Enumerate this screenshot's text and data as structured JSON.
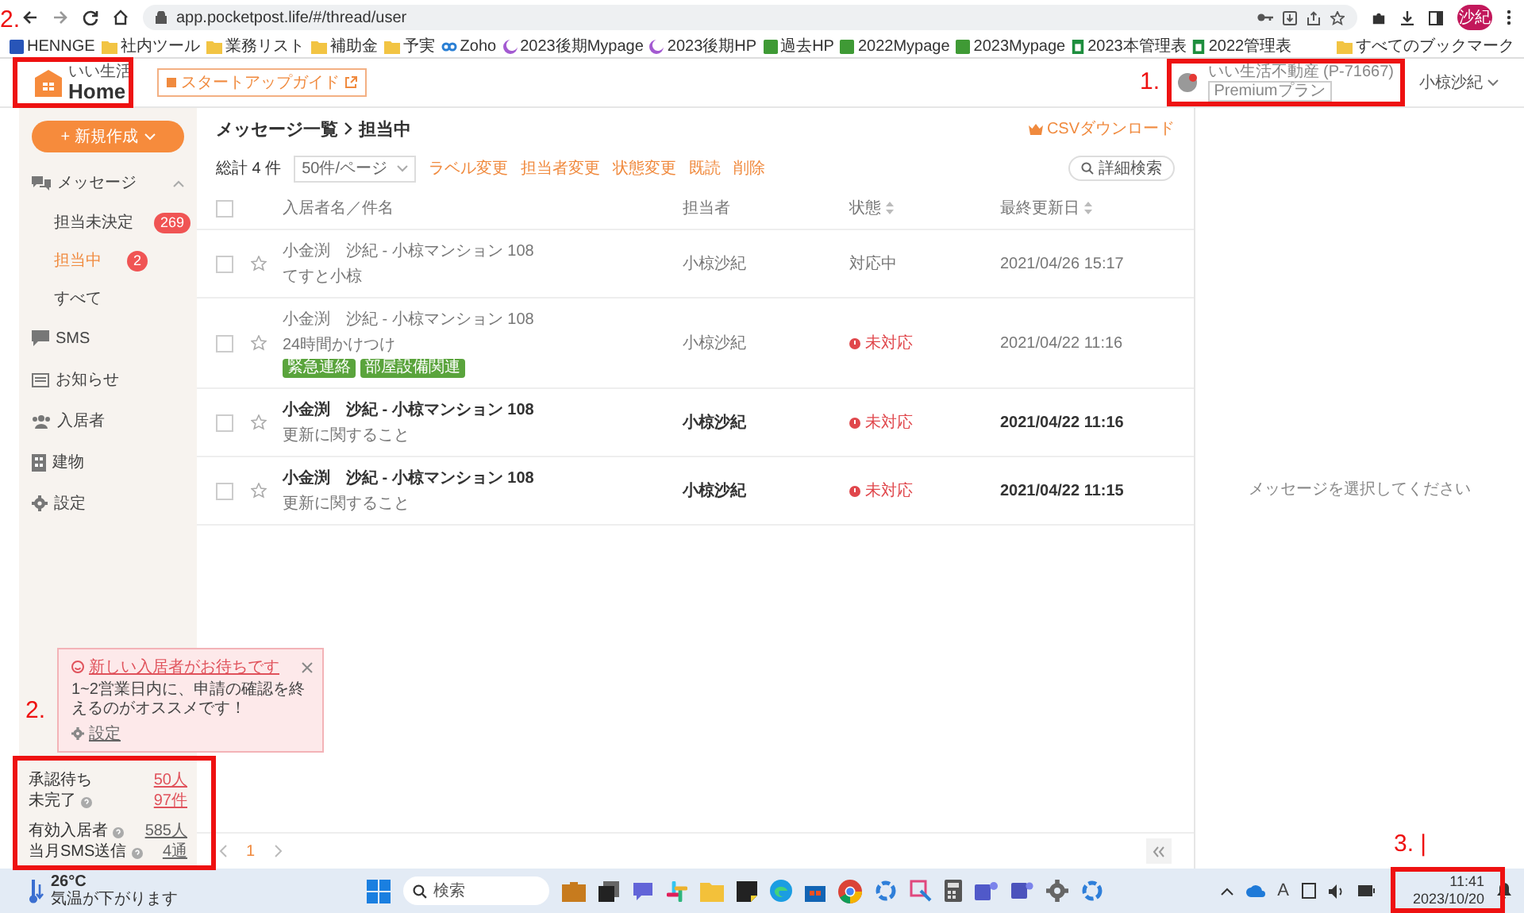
{
  "browser": {
    "url": "app.pocketpost.life/#/thread/user",
    "avatar": "沙紀",
    "all_bookmarks": "すべてのブックマーク",
    "bookmarks": [
      {
        "label": "HENNGE",
        "kind": "app"
      },
      {
        "label": "社内ツール",
        "kind": "folder"
      },
      {
        "label": "業務リスト",
        "kind": "folder"
      },
      {
        "label": "補助金",
        "kind": "folder"
      },
      {
        "label": "予実",
        "kind": "folder"
      },
      {
        "label": "Zoho",
        "kind": "zoho"
      },
      {
        "label": "2023後期Mypage",
        "kind": "mypage"
      },
      {
        "label": "2023後期HP",
        "kind": "mypage"
      },
      {
        "label": "過去HP",
        "kind": "site"
      },
      {
        "label": "2022Mypage",
        "kind": "site"
      },
      {
        "label": "2023Mypage",
        "kind": "site"
      },
      {
        "label": "2023本管理表",
        "kind": "sheet"
      },
      {
        "label": "2022管理表",
        "kind": "sheet"
      }
    ]
  },
  "header": {
    "logo_small": "いい生活",
    "logo": "Home",
    "guide": "スタートアップガイド",
    "company": "いい生活不動産 (P-71667)",
    "plan": "Premiumプラン",
    "user": "小椋沙紀"
  },
  "sidebar": {
    "new_button": "+ 新規作成",
    "items": [
      {
        "label": "メッセージ",
        "kind": "chat",
        "expanded": true,
        "children": [
          {
            "label": "担当未決定",
            "badge": "269",
            "selected": false
          },
          {
            "label": "担当中",
            "badge": "2",
            "selected": true
          },
          {
            "label": "すべて",
            "selected": false
          }
        ]
      },
      {
        "label": "SMS",
        "kind": "sms"
      },
      {
        "label": "お知らせ",
        "kind": "notice"
      },
      {
        "label": "入居者",
        "kind": "residents"
      },
      {
        "label": "建物",
        "kind": "building"
      },
      {
        "label": "設定",
        "kind": "settings"
      }
    ],
    "stats": [
      {
        "label": "承認待ち",
        "value": "50人",
        "help": false,
        "alert": true
      },
      {
        "label": "未完了",
        "value": "97件",
        "help": true,
        "alert": true
      },
      {
        "label": "有効入居者",
        "value": "585人",
        "help": true,
        "alert": false
      },
      {
        "label": "当月SMS送信",
        "value": "4通",
        "help": true,
        "alert": false
      }
    ]
  },
  "popup": {
    "title": "新しい入居者がお待ちです",
    "text": "1~2営業日内に、申請の確認を終えるのがオススメです！",
    "settings": "設定"
  },
  "list": {
    "breadcrumb": [
      "メッセージ一覧",
      "担当中"
    ],
    "csv": "CSVダウンロード",
    "total": "総計 4 件",
    "page_size": "50件/ページ",
    "actions": [
      "ラベル変更",
      "担当者変更",
      "状態変更",
      "既読",
      "削除"
    ],
    "search_button": "詳細検索",
    "columns": [
      {
        "label": "入居者名／件名",
        "sortable": false
      },
      {
        "label": "担当者",
        "sortable": false
      },
      {
        "label": "状態",
        "sortable": true
      },
      {
        "label": "最終更新日",
        "sortable": true
      }
    ],
    "all_checked": false,
    "rows": [
      {
        "checked": false,
        "name": "小金渕　沙紀 - 小椋マンション 108",
        "subject": "てすと小椋",
        "labels": [],
        "assignee": "小椋沙紀",
        "status": "対応中",
        "urgent": false,
        "updated": "2021/04/26 15:17",
        "unread": false
      },
      {
        "checked": false,
        "name": "小金渕　沙紀 - 小椋マンション 108",
        "subject": "24時間かけつけ",
        "labels": [
          "緊急連絡",
          "部屋設備関連"
        ],
        "assignee": "小椋沙紀",
        "status": "未対応",
        "urgent": true,
        "updated": "2021/04/22 11:16",
        "unread": false
      },
      {
        "checked": false,
        "name": "小金渕　沙紀 - 小椋マンション 108",
        "subject": "更新に関すること",
        "labels": [],
        "assignee": "小椋沙紀",
        "status": "未対応",
        "urgent": true,
        "updated": "2021/04/22 11:16",
        "unread": true
      },
      {
        "checked": false,
        "name": "小金渕　沙紀 - 小椋マンション 108",
        "subject": "更新に関すること",
        "labels": [],
        "assignee": "小椋沙紀",
        "status": "未対応",
        "urgent": true,
        "updated": "2021/04/22 11:15",
        "unread": true
      }
    ],
    "pages": [
      {
        "label": "1",
        "selected": true
      }
    ]
  },
  "detail": {
    "empty_text": "メッセージを選択してください"
  },
  "taskbar": {
    "temp": "26°C",
    "weather": "気温が下がります",
    "search": "検索",
    "ime": "A",
    "time": "11:41",
    "date": "2023/10/20"
  },
  "annotations": [
    {
      "number": "2."
    },
    {
      "number": "1."
    },
    {
      "number": "2."
    },
    {
      "number": "3. |"
    }
  ]
}
